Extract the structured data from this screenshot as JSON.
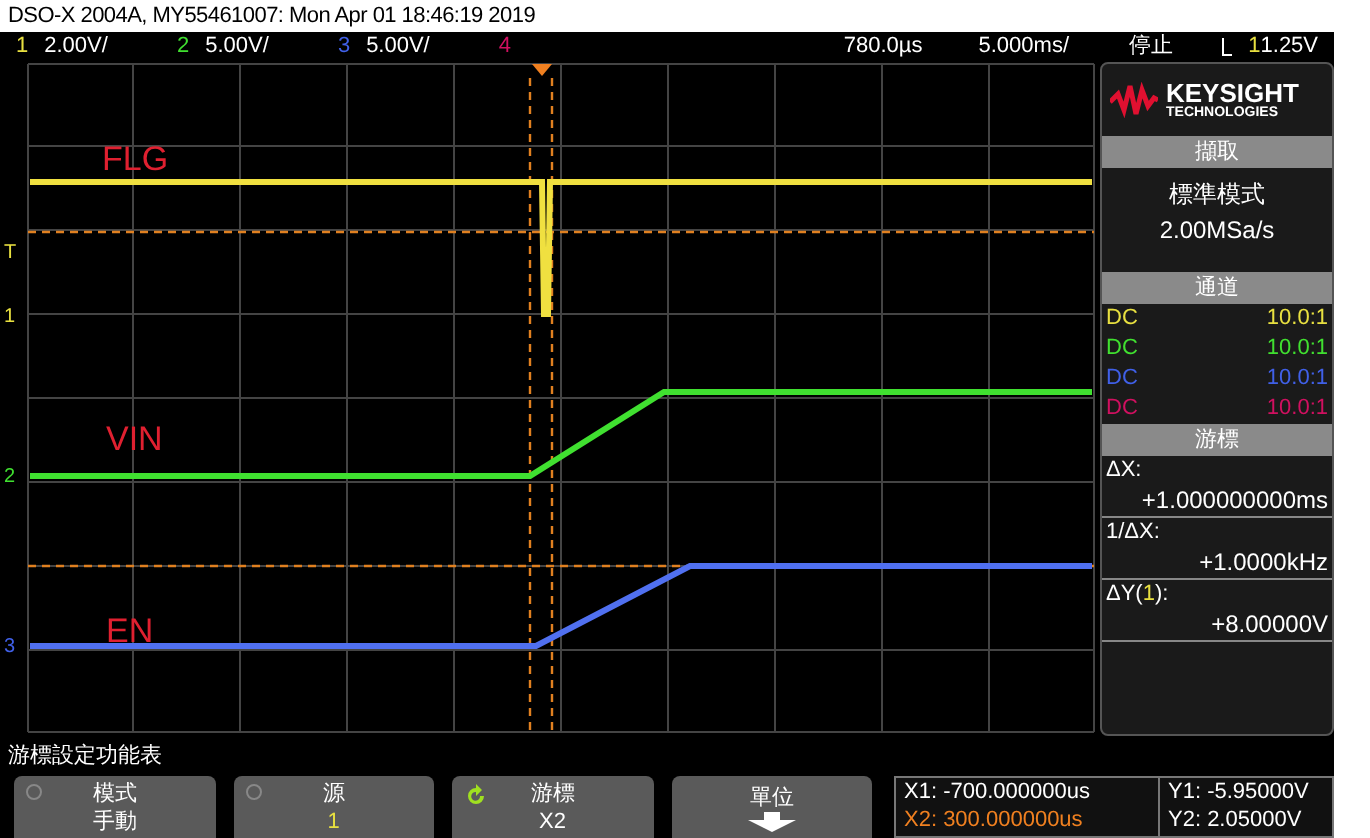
{
  "title": "DSO-X 2004A, MY55461007: Mon Apr 01 18:46:19 2019",
  "status_bar": {
    "channels": [
      {
        "number": "1",
        "scale": "2.00V/",
        "color": "#e8e040"
      },
      {
        "number": "2",
        "scale": "5.00V/",
        "color": "#40e030"
      },
      {
        "number": "3",
        "scale": "5.00V/",
        "color": "#4060e8"
      },
      {
        "number": "4",
        "color": "#d01060"
      }
    ],
    "delay": "780.0µs",
    "timebase": "5.000ms/",
    "run_state": "停止",
    "trigger_source": "1",
    "trigger_level": "1.25V"
  },
  "plot": {
    "trace_labels": [
      "FLG",
      "VIN",
      "EN"
    ],
    "markers": [
      {
        "text": "T",
        "color": "#e8e040"
      },
      {
        "text": "1",
        "color": "#e8e040"
      },
      {
        "text": "2",
        "color": "#40e030"
      },
      {
        "text": "3",
        "color": "#4060e8"
      }
    ]
  },
  "side_panel": {
    "logo": {
      "name": "KEYSIGHT",
      "subtitle": "TECHNOLOGIES"
    },
    "acquire": {
      "header": "擷取",
      "mode": "標準模式",
      "rate": "2.00MSa/s"
    },
    "channels": {
      "header": "通道",
      "rows": [
        {
          "coupling": "DC",
          "probe": "10.0:1",
          "color": "#e8e040"
        },
        {
          "coupling": "DC",
          "probe": "10.0:1",
          "color": "#40e030"
        },
        {
          "coupling": "DC",
          "probe": "10.0:1",
          "color": "#4060e8"
        },
        {
          "coupling": "DC",
          "probe": "10.0:1",
          "color": "#d01060"
        }
      ]
    },
    "cursors": {
      "header": "游標",
      "readings": [
        {
          "label": "ΔX:",
          "value": "+1.000000000ms"
        },
        {
          "label": "1/ΔX:",
          "value": "+1.0000kHz"
        },
        {
          "label": "ΔY(",
          "channel": "1",
          "label_end": "):",
          "value": "+8.00000V"
        }
      ]
    }
  },
  "menu": {
    "title": "游標設定功能表",
    "softkeys": [
      {
        "kind": "plain",
        "label": "模式",
        "value": "手動",
        "color": "#ffffff"
      },
      {
        "kind": "plain",
        "label": "源",
        "value": "1",
        "color": "#e8e040"
      },
      {
        "kind": "knob",
        "label": "游標",
        "value": "X2",
        "color": "#ffffff"
      },
      {
        "kind": "arrow",
        "label": "單位"
      }
    ]
  },
  "readout": {
    "x": [
      {
        "text": "X1: -700.000000us",
        "color": "#ffffff"
      },
      {
        "text": "X2: 300.000000us",
        "color": "#f08020"
      }
    ],
    "y": [
      {
        "text": "Y1: -5.95000V",
        "color": "#ffffff"
      },
      {
        "text": "Y2: 2.05000V",
        "color": "#ffffff"
      }
    ]
  }
}
